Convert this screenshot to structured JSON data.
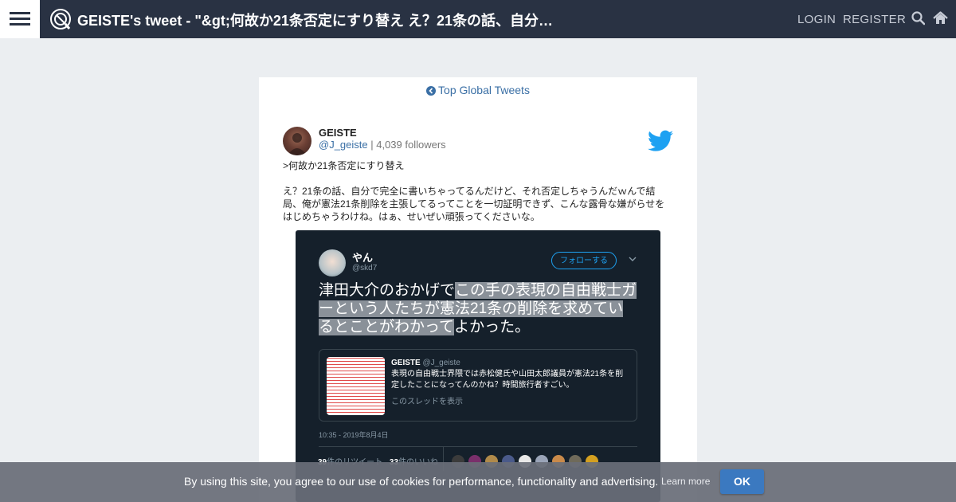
{
  "header": {
    "title": "GEISTE's tweet - \"&gt;何故か21条否定にすり替え え？21条の話、自分…",
    "login_label": "LOGIN",
    "register_label": "REGISTER",
    "icons": [
      "menu-icon",
      "site-logo-icon",
      "search-icon",
      "home-icon"
    ]
  },
  "nav": {
    "back_label": "Top Global Tweets",
    "back_icon": "arrow-circle-left-icon"
  },
  "tweet": {
    "author_name": "GEISTE",
    "author_handle": "@J_geiste",
    "followers": "| 4,039 followers",
    "paragraph1": ">何故か21条否定にすり替え",
    "paragraph2": "え？21条の話、自分で完全に書いちゃってるんだけど、それ否定しちゃうんだｗんで結局、俺が憲法21条削除を主張してるってことを一切証明できず、こんな露骨な嫌がらせをはじめちゃうわけね。はぁ、せいぜい頑張ってくださいな。",
    "source_icon": "twitter-bird-icon"
  },
  "embedded": {
    "name": "やん",
    "handle": "@skd7",
    "follow_label": "フォローする",
    "text_before": "津田大介のおかげで",
    "text_highlight": "この手の表現の自由戦士ガーという人たちが憲法21条の削除を求めているとことがわかって",
    "text_after": "よかった。",
    "quote_name": "GEISTE",
    "quote_handle": "@J_geiste",
    "quote_body": "表現の自由戦士界隈では赤松健氏や山田太郎議員が憲法21条を削定したことになってんのかね？時間旅行者すごい。",
    "quote_link": "このスレッドを表示",
    "timestamp": "10:35 - 2019年8月4日",
    "retweets_count": "39",
    "retweets_label": "件のリツイート",
    "likes_count": "33",
    "likes_label": "件のいいね"
  },
  "cookie": {
    "message": "By using this site, you agree to our use of cookies for performance, functionality and advertising.",
    "learn_more": "Learn more",
    "ok_label": "OK"
  },
  "colors": {
    "topbar": "#293243",
    "page_bg": "#ebeef1",
    "link": "#3a6fa5",
    "twitter_blue": "#1da1f2",
    "embedded_bg": "#15202b",
    "ok_button": "#3b79c0"
  }
}
